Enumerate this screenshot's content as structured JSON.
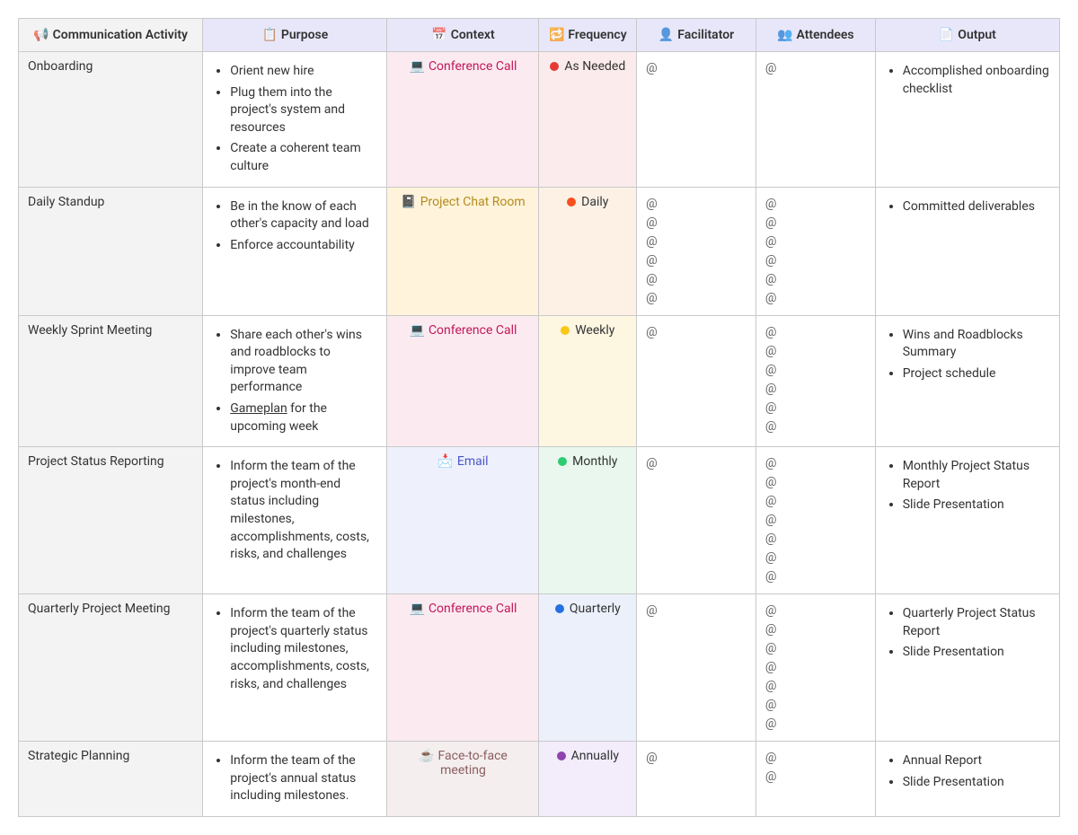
{
  "headers": {
    "activity": "Communication Activity",
    "purpose": "Purpose",
    "context": "Context",
    "frequency": "Frequency",
    "facilitator": "Facilitator",
    "attendees": "Attendees",
    "output": "Output"
  },
  "header_icons": {
    "activity": "📢",
    "purpose": "📋",
    "context": "📅",
    "frequency": "🔁",
    "facilitator": "👤",
    "attendees": "👥",
    "output": "📄"
  },
  "context_labels": {
    "conference": "Conference Call",
    "chat": "Project Chat Room",
    "email": "Email",
    "face": "Face-to-face meeting"
  },
  "context_icons": {
    "conference": "💻",
    "chat": "📓",
    "email": "📩",
    "face": "☕"
  },
  "frequency_labels": {
    "asneeded": "As Needed",
    "daily": "Daily",
    "weekly": "Weekly",
    "monthly": "Monthly",
    "quarterly": "Quarterly",
    "annually": "Annually"
  },
  "at_symbol": "@",
  "rows": [
    {
      "activity": "Onboarding",
      "purpose": [
        "Orient new hire",
        "Plug them into the project's system and resources",
        "Create a coherent team culture"
      ],
      "context": "conference",
      "frequency": "asneeded",
      "facilitator_count": 1,
      "attendees_count": 1,
      "output": [
        "Accomplished onboarding checklist"
      ]
    },
    {
      "activity": "Daily Standup",
      "purpose": [
        "Be in the know of each other's capacity and load",
        "Enforce accountability"
      ],
      "context": "chat",
      "frequency": "daily",
      "facilitator_count": 6,
      "attendees_count": 6,
      "output": [
        "Committed deliverables"
      ]
    },
    {
      "activity": "Weekly Sprint Meeting",
      "purpose": [
        "Share each other's wins and roadblocks to improve team performance",
        "<u>Gameplan</u> for the upcoming week"
      ],
      "context": "conference",
      "frequency": "weekly",
      "facilitator_count": 1,
      "attendees_count": 6,
      "output": [
        "Wins and Roadblocks Summary",
        "Project schedule"
      ]
    },
    {
      "activity": "Project Status Reporting",
      "purpose": [
        "Inform the team of the project's month-end status including milestones, accomplishments, costs, risks, and challenges"
      ],
      "context": "email",
      "frequency": "monthly",
      "facilitator_count": 1,
      "attendees_count": 7,
      "output": [
        "Monthly Project Status Report",
        "Slide Presentation"
      ]
    },
    {
      "activity": "Quarterly Project Meeting",
      "purpose": [
        "Inform the team of the project's quarterly status including milestones, accomplishments, costs, risks, and challenges"
      ],
      "context": "conference",
      "frequency": "quarterly",
      "facilitator_count": 1,
      "attendees_count": 7,
      "output": [
        "Quarterly Project Status Report",
        "Slide Presentation"
      ]
    },
    {
      "activity": "Strategic Planning",
      "purpose": [
        "Inform the team of the project's annual status including milestones."
      ],
      "context": "face",
      "frequency": "annually",
      "facilitator_count": 1,
      "attendees_count": 2,
      "output": [
        "Annual Report",
        "Slide Presentation"
      ]
    }
  ]
}
